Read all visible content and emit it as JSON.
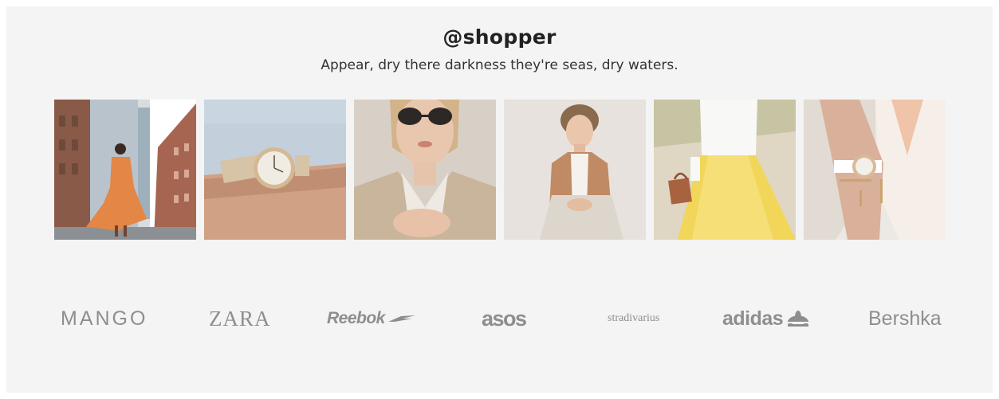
{
  "header": {
    "handle": "@shopper",
    "tagline": "Appear, dry there darkness they're seas, dry waters."
  },
  "gallery": {
    "photos": [
      {
        "icon": "woman-orange-dress-city-street-photo"
      },
      {
        "icon": "wristwatch-denim-sleeve-photo"
      },
      {
        "icon": "woman-sunglasses-trench-coat-photo"
      },
      {
        "icon": "man-camel-blazer-seated-photo"
      },
      {
        "icon": "yellow-gingham-skirt-handbag-photo"
      },
      {
        "icon": "wrist-watch-white-blouse-photo"
      }
    ]
  },
  "brands": {
    "mango": "MANGO",
    "zara": "ZARA",
    "reebok": "Reebok",
    "asos": "asos",
    "stradivarius": "stradivarius",
    "adidas": "adidas",
    "bershka": "Bershka"
  },
  "colors": {
    "section_background": "#f4f4f4",
    "brand_gray": "#8e8e8e",
    "heading": "#222222"
  }
}
